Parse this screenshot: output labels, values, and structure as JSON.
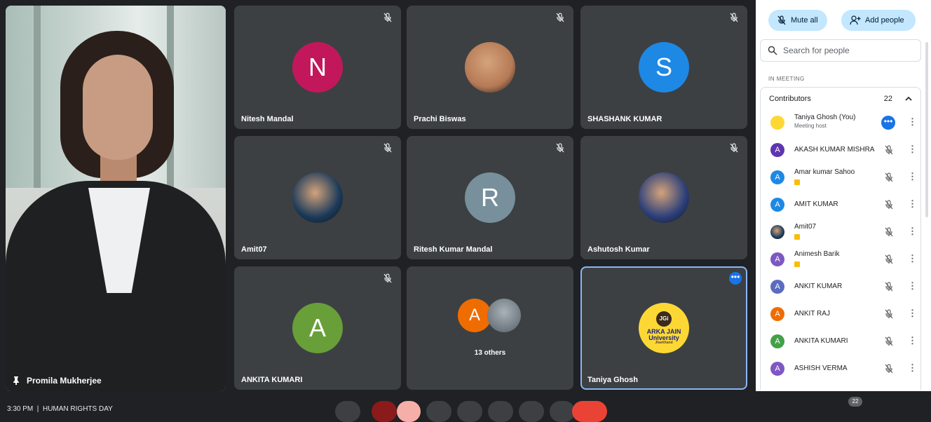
{
  "meeting": {
    "time_label": "3:30 PM",
    "title": "HUMAN RIGHTS DAY",
    "participant_badge": "22"
  },
  "pinned": {
    "name": "Promila Mukherjee"
  },
  "tiles": [
    {
      "name": "Nitesh Mandal",
      "initial": "N",
      "color": "#c2185b"
    },
    {
      "name": "Prachi Biswas",
      "initial": "",
      "color": "#b57a56"
    },
    {
      "name": "SHASHANK KUMAR",
      "initial": "S",
      "color": "#1e88e5"
    },
    {
      "name": "Amit07",
      "initial": "",
      "color": "#1b3a5a"
    },
    {
      "name": "Ritesh Kumar Mandal",
      "initial": "R",
      "color": "#78909c"
    },
    {
      "name": "Ashutosh Kumar",
      "initial": "",
      "color": "#2b3f7a"
    },
    {
      "name": "ANKITA KUMARI",
      "initial": "A",
      "color": "#689f38"
    },
    {
      "name": "13 others",
      "initial": "A",
      "color": "#ef6c00"
    },
    {
      "name": "Taniya Ghosh",
      "initial": "",
      "color": "#fdd835"
    }
  ],
  "logo": {
    "jgi": "JGi",
    "line1": "ARKA JAIN",
    "line2": "University",
    "line3": "Jharkhand"
  },
  "panel": {
    "mute_all": "Mute all",
    "add_people": "Add people",
    "search_placeholder": "Search for people",
    "section": "IN MEETING",
    "group_label": "Contributors",
    "group_count": "22",
    "participants": [
      {
        "name": "Taniya Ghosh (You)",
        "sub": "Meeting host",
        "initial": "",
        "color": "#fdd835"
      },
      {
        "name": "AKASH KUMAR MISHRA",
        "initial": "A",
        "color": "#5e35b1"
      },
      {
        "name": "Amar kumar Sahoo",
        "initial": "A",
        "color": "#1e88e5",
        "hand": true
      },
      {
        "name": "AMIT KUMAR",
        "initial": "A",
        "color": "#1e88e5"
      },
      {
        "name": "Amit07",
        "initial": "",
        "color": "#1b3a5a",
        "hand": true
      },
      {
        "name": "Animesh Barik",
        "initial": "A",
        "color": "#7e57c2",
        "hand": true
      },
      {
        "name": "ANKIT KUMAR",
        "initial": "A",
        "color": "#5c6bc0"
      },
      {
        "name": "ANKIT RAJ",
        "initial": "A",
        "color": "#ef6c00"
      },
      {
        "name": "ANKITA KUMARI",
        "initial": "A",
        "color": "#43a047"
      },
      {
        "name": "ASHISH VERMA",
        "initial": "A",
        "color": "#7e57c2"
      }
    ]
  }
}
